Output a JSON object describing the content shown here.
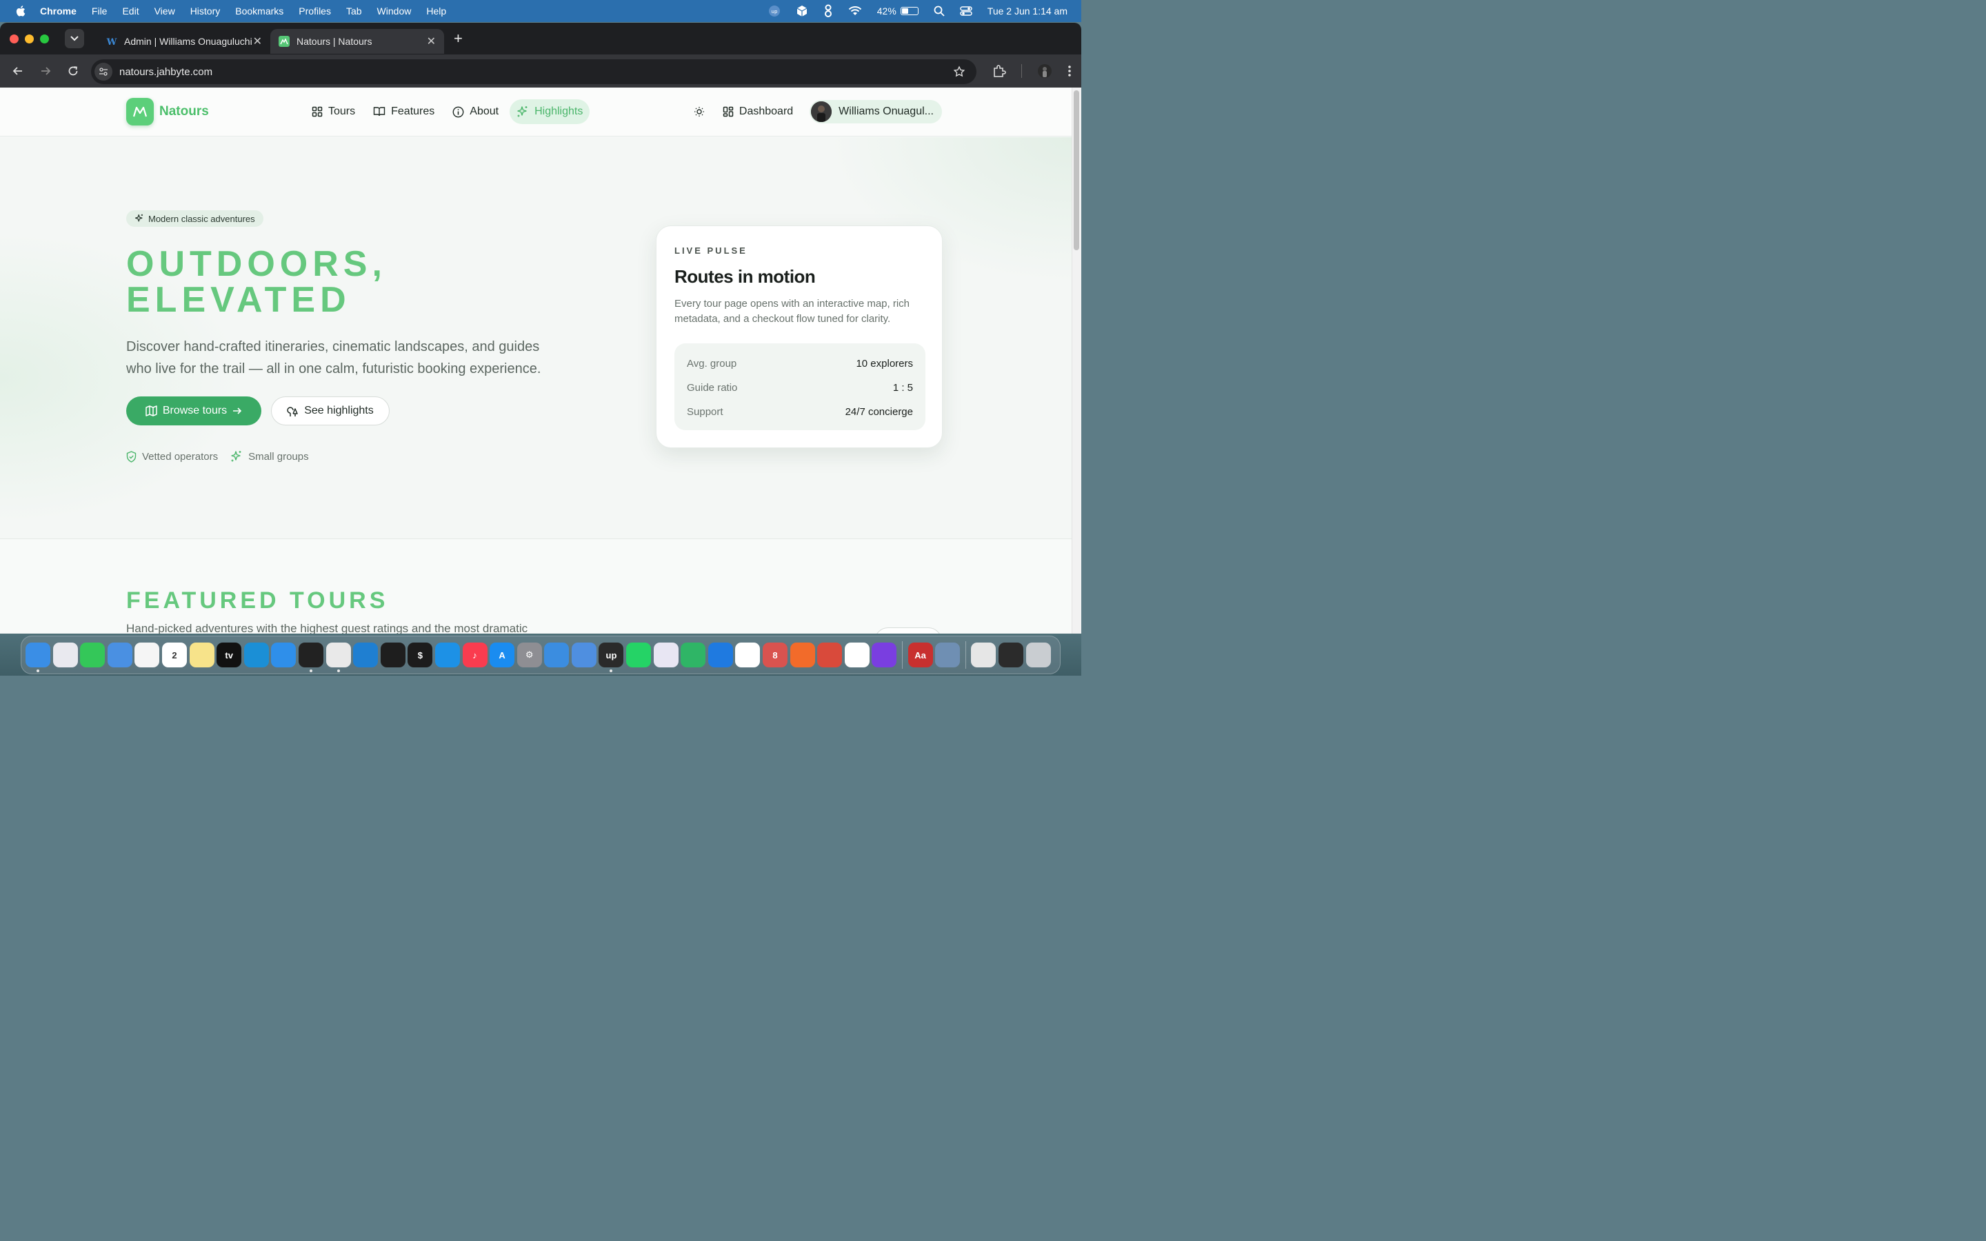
{
  "menubar": {
    "app": "Chrome",
    "items": [
      "File",
      "Edit",
      "View",
      "History",
      "Bookmarks",
      "Profiles",
      "Tab",
      "Window",
      "Help"
    ],
    "battery": "42%",
    "battery_level": 0.42,
    "datetime": "Tue 2 Jun  1:14 am"
  },
  "browser": {
    "tabs": [
      {
        "title": "Admin | Williams Onuaguluchi",
        "icon": "wordpress-icon"
      },
      {
        "title": "Natours | Natours",
        "icon": "natours-favicon"
      }
    ],
    "url": "natours.jahbyte.com"
  },
  "site": {
    "brand": "Natours",
    "nav": [
      "Tours",
      "Features",
      "About",
      "Highlights"
    ],
    "dashboard_label": "Dashboard",
    "user_name": "Williams Onuagul..."
  },
  "hero": {
    "badge": "Modern classic adventures",
    "headline_line1": "OUTDOORS,",
    "headline_line2": "ELEVATED",
    "lede": "Discover hand-crafted itineraries, cinematic landscapes, and guides who live for the trail — all in one calm, futuristic booking experience.",
    "primary_cta": "Browse tours",
    "secondary_cta": "See highlights",
    "trust": [
      "Vetted operators",
      "Small groups"
    ]
  },
  "pulse": {
    "kicker": "LIVE PULSE",
    "title": "Routes in motion",
    "description": "Every tour page opens with an interactive map, rich metadata, and a checkout flow tuned for clarity.",
    "stats": [
      {
        "label": "Avg. group",
        "value": "10 explorers"
      },
      {
        "label": "Guide ratio",
        "value": "1 : 5"
      },
      {
        "label": "Support",
        "value": "24/7 concierge"
      }
    ]
  },
  "featured": {
    "title": "FEATURED TOURS",
    "subtitle": "Hand-picked adventures with the highest guest ratings and the most dramatic"
  },
  "colors": {
    "brand_green": "#4cbf6b",
    "headline_green": "#66c87e",
    "primary_button": "#3aaa65",
    "menubar_blue": "#2b6fae"
  },
  "dock": {
    "apps": [
      {
        "name": "finder-icon",
        "color": "#3a8ee6",
        "running": true,
        "glyph": ""
      },
      {
        "name": "launchpad-icon",
        "color": "#e9e9ef",
        "running": false,
        "glyph": ""
      },
      {
        "name": "messages-icon",
        "color": "#34c759",
        "running": false,
        "glyph": ""
      },
      {
        "name": "mail-icon",
        "color": "#4a90e2",
        "running": false,
        "glyph": ""
      },
      {
        "name": "photos-icon",
        "color": "#f5f5f5",
        "running": false,
        "glyph": ""
      },
      {
        "name": "calendar-icon",
        "color": "#ffffff",
        "running": false,
        "glyph": "2"
      },
      {
        "name": "notes-icon",
        "color": "#f7e38a",
        "running": false,
        "glyph": ""
      },
      {
        "name": "apple-tv-icon",
        "color": "#111111",
        "running": false,
        "glyph": "tv"
      },
      {
        "name": "edge-icon",
        "color": "#1b8fd6",
        "running": false,
        "glyph": ""
      },
      {
        "name": "safari-icon",
        "color": "#2f8fea",
        "running": false,
        "glyph": ""
      },
      {
        "name": "cursor-icon",
        "color": "#222222",
        "running": true,
        "glyph": ""
      },
      {
        "name": "chrome-icon",
        "color": "#e9e9e9",
        "running": true,
        "glyph": ""
      },
      {
        "name": "vscode-icon",
        "color": "#1f7fd1",
        "running": false,
        "glyph": ""
      },
      {
        "name": "figma-icon",
        "color": "#1e1e1e",
        "running": false,
        "glyph": ""
      },
      {
        "name": "terminal-icon",
        "color": "#1c1c1c",
        "running": false,
        "glyph": "$"
      },
      {
        "name": "docker-icon",
        "color": "#1d91e6",
        "running": false,
        "glyph": ""
      },
      {
        "name": "music-icon",
        "color": "#fa3c4f",
        "running": false,
        "glyph": "♪"
      },
      {
        "name": "app-store-icon",
        "color": "#1a8cf0",
        "running": false,
        "glyph": "A"
      },
      {
        "name": "system-settings-icon",
        "color": "#8e8e93",
        "running": false,
        "glyph": "⚙"
      },
      {
        "name": "files-icon",
        "color": "#3b8de0",
        "running": false,
        "glyph": ""
      },
      {
        "name": "simulator-icon",
        "color": "#4f8fe0",
        "running": false,
        "glyph": ""
      },
      {
        "name": "upwork-icon",
        "color": "#2a2a2a",
        "running": true,
        "glyph": "up"
      },
      {
        "name": "whatsapp-icon",
        "color": "#25d366",
        "running": false,
        "glyph": ""
      },
      {
        "name": "proton-vpn-icon",
        "color": "#e8e6f3",
        "running": false,
        "glyph": ""
      },
      {
        "name": "network-icon",
        "color": "#2fb566",
        "running": false,
        "glyph": ""
      },
      {
        "name": "xcode-icon",
        "color": "#1f7ae0",
        "running": false,
        "glyph": ""
      },
      {
        "name": "mongodb-icon",
        "color": "#ffffff",
        "running": false,
        "glyph": ""
      },
      {
        "name": "git-client-icon",
        "color": "#d9534f",
        "running": false,
        "glyph": "8"
      },
      {
        "name": "pen-tool-icon",
        "color": "#f26b2a",
        "running": false,
        "glyph": ""
      },
      {
        "name": "toolbox-icon",
        "color": "#d94a3b",
        "running": false,
        "glyph": ""
      },
      {
        "name": "numbers-icon",
        "color": "#ffffff",
        "running": false,
        "glyph": ""
      },
      {
        "name": "firefox-icon",
        "color": "#7a3ee0",
        "running": false,
        "glyph": ""
      },
      {
        "name": "dictionary-icon",
        "color": "#c8302f",
        "running": false,
        "glyph": "Aa"
      },
      {
        "name": "disk-utility-icon",
        "color": "#6f8fb3",
        "running": false,
        "glyph": ""
      },
      {
        "name": "documents-folder-icon",
        "color": "#e6e6e6",
        "running": false,
        "glyph": ""
      },
      {
        "name": "screenshots-folder-icon",
        "color": "#2b2b2b",
        "running": false,
        "glyph": ""
      },
      {
        "name": "trash-icon",
        "color": "#c9cdd1",
        "running": false,
        "glyph": ""
      }
    ]
  }
}
